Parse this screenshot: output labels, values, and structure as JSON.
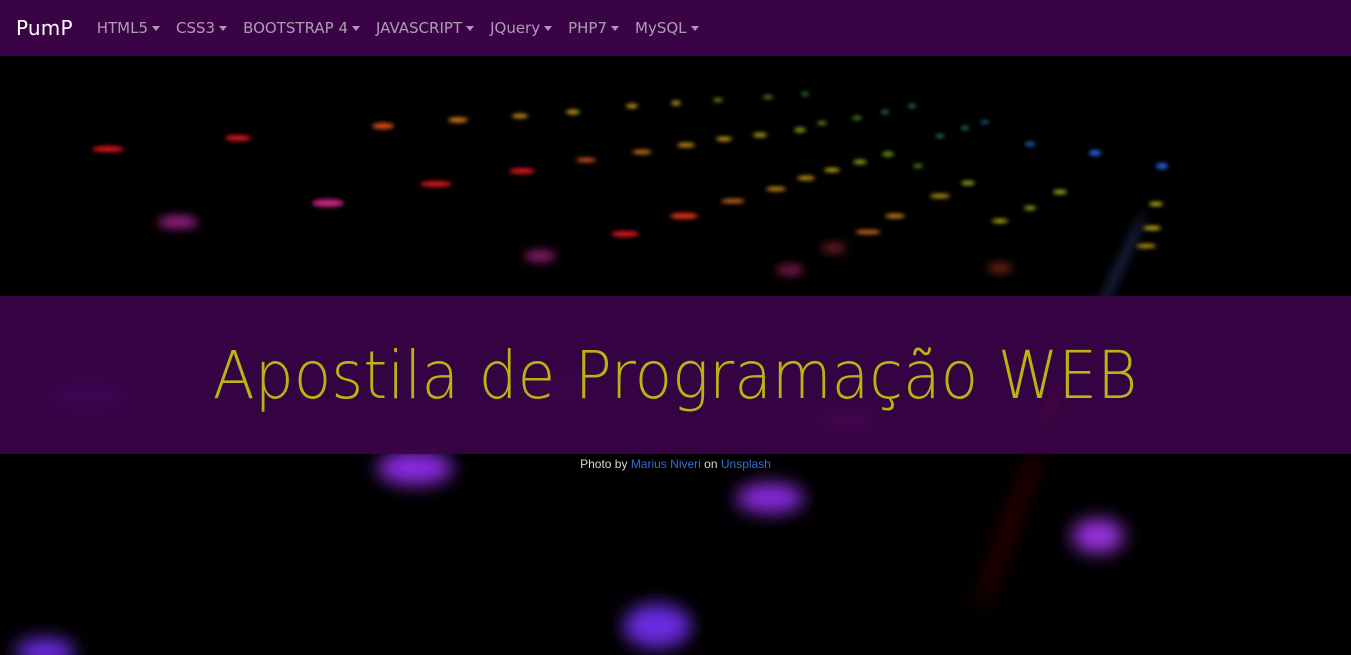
{
  "navbar": {
    "brand": "PumP",
    "items": [
      {
        "label": "HTML5"
      },
      {
        "label": "CSS3"
      },
      {
        "label": "BOOTSTRAP 4"
      },
      {
        "label": "JAVASCRIPT"
      },
      {
        "label": "JQuery"
      },
      {
        "label": "PHP7"
      },
      {
        "label": "MySQL"
      }
    ],
    "background": "#390346"
  },
  "hero": {
    "title": "Apostila de Programação WEB",
    "title_color": "#b9b314",
    "banner_color": "#390346",
    "image_description_icon": "keyboard-rgb-lights-photo"
  },
  "credit": {
    "prefix": "Photo by",
    "author": "Marius Niveri",
    "middle": "on",
    "site": "Unsplash",
    "link_color": "#2f6fd6"
  }
}
